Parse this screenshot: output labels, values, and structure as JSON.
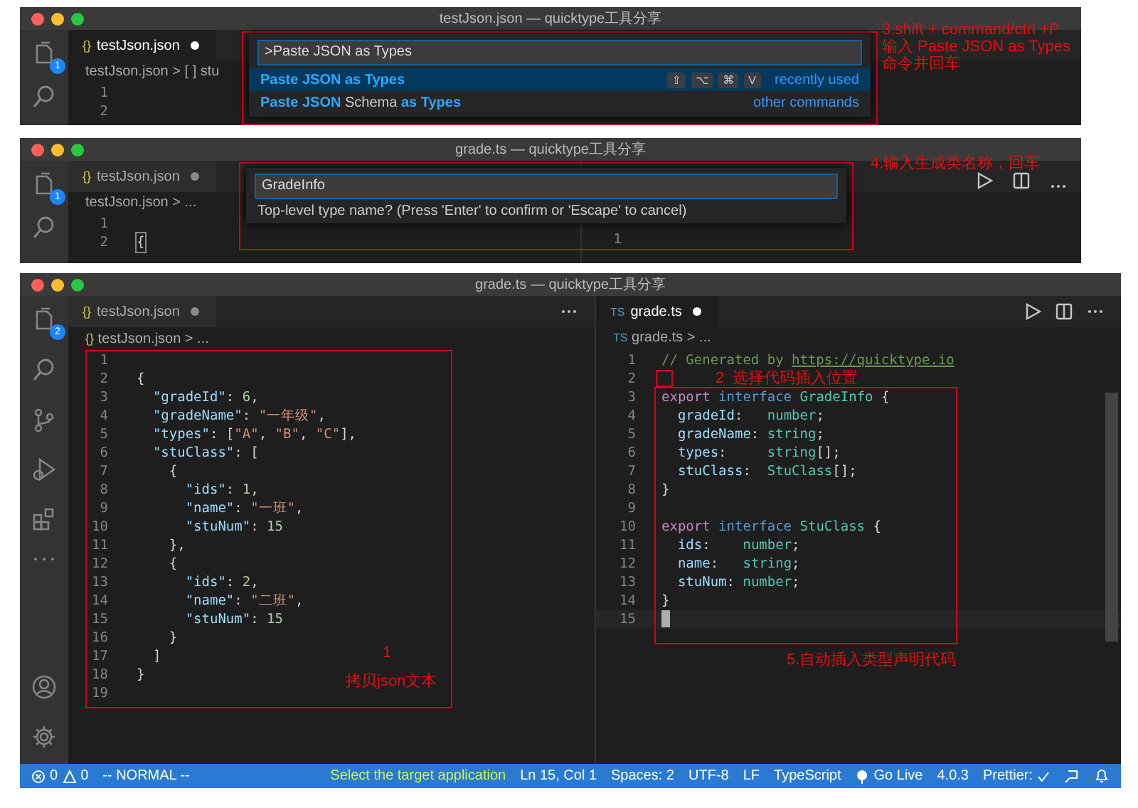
{
  "step3_window": {
    "title": "testJson.json — quicktype工具分享",
    "files_badge": "1",
    "tab": {
      "icon": "{}",
      "label": "testJson.json",
      "modified": true
    },
    "breadcrumb": "testJson.json > [ ] stu",
    "line_numbers": [
      "1",
      "2"
    ],
    "palette": {
      "value": ">Paste JSON as Types",
      "items": [
        {
          "selected": true,
          "segments": [
            {
              "text": "Paste JSON as Types",
              "match": true
            }
          ],
          "keys": [
            "⇧",
            "⌥",
            "⌘",
            "V"
          ],
          "hint": "recently used"
        },
        {
          "selected": false,
          "segments": [
            {
              "text": "Paste JSON",
              "match": true
            },
            {
              "text": " Schema ",
              "match": false
            },
            {
              "text": "as Types",
              "match": true
            }
          ],
          "hint": "other commands"
        }
      ]
    },
    "annotation": [
      "3.shift + command/ctrl +P",
      "输入 Paste JSON as Types",
      "命令并回车"
    ]
  },
  "step4_window": {
    "title": "grade.ts — quicktype工具分享",
    "files_badge": "1",
    "tab": {
      "icon": "{}",
      "label": "testJson.json",
      "modified": true
    },
    "breadcrumb": "testJson.json > ...",
    "lines": [
      {
        "number": "1"
      },
      {
        "number": "2",
        "text": "{"
      }
    ],
    "right_line_number": "1",
    "input": {
      "value": "GradeInfo",
      "message": "Top-level type name? (Press 'Enter' to confirm or 'Escape' to cancel)"
    },
    "annotation": "4.输入生成类名称，回车"
  },
  "main_window": {
    "title": "grade.ts — quicktype工具分享",
    "files_badge": "2",
    "left": {
      "tab": {
        "icon": "{}",
        "label": "testJson.json",
        "modified": true
      },
      "breadcrumb_icon": "{}",
      "breadcrumb": "testJson.json > ...",
      "lines": [
        {
          "number": "1"
        },
        {
          "number": "2",
          "tokens": [
            {
              "text": "{",
              "kind": "punct"
            }
          ]
        },
        {
          "number": "3",
          "tokens": [
            {
              "text": "  \"gradeId\"",
              "kind": "key"
            },
            {
              "text": ": ",
              "kind": "punct"
            },
            {
              "text": "6",
              "kind": "number"
            },
            {
              "text": ",",
              "kind": "punct"
            }
          ]
        },
        {
          "number": "4",
          "tokens": [
            {
              "text": "  \"gradeName\"",
              "kind": "key"
            },
            {
              "text": ": ",
              "kind": "punct"
            },
            {
              "text": "\"一年级\"",
              "kind": "string"
            },
            {
              "text": ",",
              "kind": "punct"
            }
          ]
        },
        {
          "number": "5",
          "tokens": [
            {
              "text": "  \"types\"",
              "kind": "key"
            },
            {
              "text": ": [",
              "kind": "punct"
            },
            {
              "text": "\"A\"",
              "kind": "string"
            },
            {
              "text": ", ",
              "kind": "punct"
            },
            {
              "text": "\"B\"",
              "kind": "string"
            },
            {
              "text": ", ",
              "kind": "punct"
            },
            {
              "text": "\"C\"",
              "kind": "string"
            },
            {
              "text": "],",
              "kind": "punct"
            }
          ]
        },
        {
          "number": "6",
          "tokens": [
            {
              "text": "  \"stuClass\"",
              "kind": "key"
            },
            {
              "text": ": [",
              "kind": "punct"
            }
          ]
        },
        {
          "number": "7",
          "tokens": [
            {
              "text": "    {",
              "kind": "punct"
            }
          ]
        },
        {
          "number": "8",
          "tokens": [
            {
              "text": "      \"ids\"",
              "kind": "key"
            },
            {
              "text": ": ",
              "kind": "punct"
            },
            {
              "text": "1",
              "kind": "number"
            },
            {
              "text": ",",
              "kind": "punct"
            }
          ]
        },
        {
          "number": "9",
          "tokens": [
            {
              "text": "      \"name\"",
              "kind": "key"
            },
            {
              "text": ": ",
              "kind": "punct"
            },
            {
              "text": "\"一班\"",
              "kind": "string"
            },
            {
              "text": ",",
              "kind": "punct"
            }
          ]
        },
        {
          "number": "10",
          "tokens": [
            {
              "text": "      \"stuNum\"",
              "kind": "key"
            },
            {
              "text": ": ",
              "kind": "punct"
            },
            {
              "text": "15",
              "kind": "number"
            }
          ]
        },
        {
          "number": "11",
          "tokens": [
            {
              "text": "    },",
              "kind": "punct"
            }
          ]
        },
        {
          "number": "12",
          "tokens": [
            {
              "text": "    {",
              "kind": "punct"
            }
          ]
        },
        {
          "number": "13",
          "tokens": [
            {
              "text": "      \"ids\"",
              "kind": "key"
            },
            {
              "text": ": ",
              "kind": "punct"
            },
            {
              "text": "2",
              "kind": "number"
            },
            {
              "text": ",",
              "kind": "punct"
            }
          ]
        },
        {
          "number": "14",
          "tokens": [
            {
              "text": "      \"name\"",
              "kind": "key"
            },
            {
              "text": ": ",
              "kind": "punct"
            },
            {
              "text": "\"二班\"",
              "kind": "string"
            },
            {
              "text": ",",
              "kind": "punct"
            }
          ]
        },
        {
          "number": "15",
          "tokens": [
            {
              "text": "      \"stuNum\"",
              "kind": "key"
            },
            {
              "text": ": ",
              "kind": "punct"
            },
            {
              "text": "15",
              "kind": "number"
            }
          ]
        },
        {
          "number": "16",
          "tokens": [
            {
              "text": "    }",
              "kind": "punct"
            }
          ]
        },
        {
          "number": "17",
          "tokens": [
            {
              "text": "  ]",
              "kind": "punct"
            }
          ]
        },
        {
          "number": "18",
          "tokens": [
            {
              "text": "}",
              "kind": "punct"
            }
          ]
        },
        {
          "number": "19"
        }
      ],
      "annotation_number": "1",
      "annotation": "拷贝json文本"
    },
    "right": {
      "tab": {
        "icon": "TS",
        "label": "grade.ts",
        "modified": true
      },
      "breadcrumb_icon": "TS",
      "breadcrumb": "grade.ts > ...",
      "lines": [
        {
          "number": "1",
          "tokens": [
            {
              "text": "// Generated by ",
              "kind": "comment"
            },
            {
              "text": "https://quicktype.io",
              "kind": "link"
            }
          ]
        },
        {
          "number": "2"
        },
        {
          "number": "3",
          "tokens": [
            {
              "text": "export ",
              "kind": "export"
            },
            {
              "text": "interface ",
              "kind": "interface"
            },
            {
              "text": "GradeInfo",
              "kind": "type"
            },
            {
              "text": " {",
              "kind": "punct"
            }
          ]
        },
        {
          "number": "4",
          "tokens": [
            {
              "text": "  gradeId",
              "kind": "field"
            },
            {
              "text": ":   ",
              "kind": "punct"
            },
            {
              "text": "number",
              "kind": "type"
            },
            {
              "text": ";",
              "kind": "punct"
            }
          ]
        },
        {
          "number": "5",
          "tokens": [
            {
              "text": "  gradeName",
              "kind": "field"
            },
            {
              "text": ": ",
              "kind": "punct"
            },
            {
              "text": "string",
              "kind": "type"
            },
            {
              "text": ";",
              "kind": "punct"
            }
          ]
        },
        {
          "number": "6",
          "tokens": [
            {
              "text": "  types",
              "kind": "field"
            },
            {
              "text": ":     ",
              "kind": "punct"
            },
            {
              "text": "string",
              "kind": "type"
            },
            {
              "text": "[];",
              "kind": "punct"
            }
          ]
        },
        {
          "number": "7",
          "tokens": [
            {
              "text": "  stuClass",
              "kind": "field"
            },
            {
              "text": ":  ",
              "kind": "punct"
            },
            {
              "text": "StuClass",
              "kind": "type"
            },
            {
              "text": "[];",
              "kind": "punct"
            }
          ]
        },
        {
          "number": "8",
          "tokens": [
            {
              "text": "}",
              "kind": "punct"
            }
          ]
        },
        {
          "number": "9"
        },
        {
          "number": "10",
          "tokens": [
            {
              "text": "export ",
              "kind": "export"
            },
            {
              "text": "interface ",
              "kind": "interface"
            },
            {
              "text": "StuClass",
              "kind": "type"
            },
            {
              "text": " {",
              "kind": "punct"
            }
          ]
        },
        {
          "number": "11",
          "tokens": [
            {
              "text": "  ids",
              "kind": "field"
            },
            {
              "text": ":    ",
              "kind": "punct"
            },
            {
              "text": "number",
              "kind": "type"
            },
            {
              "text": ";",
              "kind": "punct"
            }
          ]
        },
        {
          "number": "12",
          "tokens": [
            {
              "text": "  name",
              "kind": "field"
            },
            {
              "text": ":   ",
              "kind": "punct"
            },
            {
              "text": "string",
              "kind": "type"
            },
            {
              "text": ";",
              "kind": "punct"
            }
          ]
        },
        {
          "number": "13",
          "tokens": [
            {
              "text": "  stuNum",
              "kind": "field"
            },
            {
              "text": ": ",
              "kind": "punct"
            },
            {
              "text": "number",
              "kind": "type"
            },
            {
              "text": ";",
              "kind": "punct"
            }
          ]
        },
        {
          "number": "14",
          "tokens": [
            {
              "text": "}",
              "kind": "punct"
            }
          ]
        },
        {
          "number": "15"
        }
      ],
      "annotation_number": "2",
      "annotation_small": "选择代码插入位置",
      "annotation": "5.自动插入类型声明代码"
    },
    "status_bar": {
      "errors": "0",
      "warnings": "0",
      "mode": "-- NORMAL --",
      "message": "Select the target application",
      "items": [
        "Ln 15, Col 1",
        "Spaces: 2",
        "UTF-8",
        "LF",
        "TypeScript"
      ],
      "go_live": "Go Live",
      "version": "4.0.3",
      "prettier": "Prettier:"
    }
  }
}
